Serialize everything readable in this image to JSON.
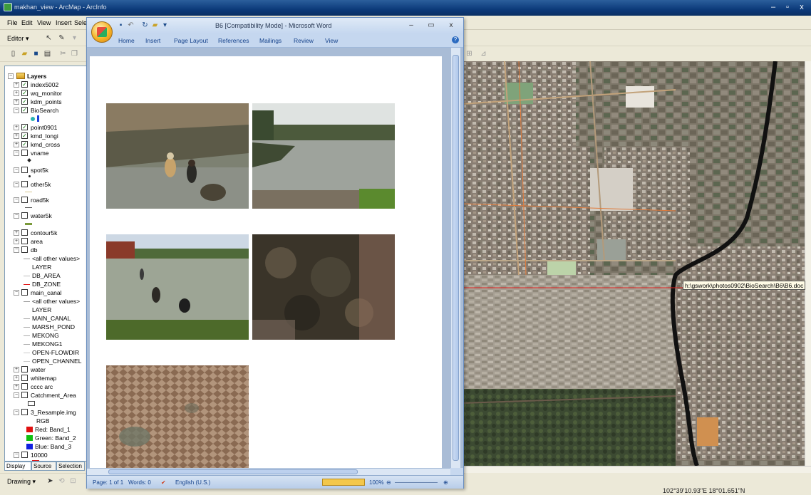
{
  "arcmap": {
    "title": "makhan_view - ArcMap - ArcInfo",
    "window_buttons": [
      "–",
      "▫",
      "x"
    ],
    "menu": [
      "File",
      "Edit",
      "View",
      "Insert",
      "Selec"
    ],
    "editor_label": "Editor ▾",
    "toc": {
      "root": "Layers",
      "layers": [
        {
          "name": "index5002",
          "checked": true
        },
        {
          "name": "wq_monitor",
          "checked": true
        },
        {
          "name": "kdm_points",
          "checked": true
        },
        {
          "name": "BioSearch",
          "checked": true
        },
        {
          "name": "point0901",
          "checked": true
        },
        {
          "name": "kmd_longi",
          "checked": true
        },
        {
          "name": "kmd_cross",
          "checked": true
        },
        {
          "name": "vname",
          "checked": false
        },
        {
          "name": "spot5k",
          "checked": false
        },
        {
          "name": "other5k",
          "checked": false
        },
        {
          "name": "road5k",
          "checked": false
        },
        {
          "name": "water5k",
          "checked": false
        },
        {
          "name": "contour5k",
          "checked": false
        },
        {
          "name": "area",
          "checked": false
        },
        {
          "name": "db",
          "checked": false
        }
      ],
      "db_legend": [
        "<all other values>",
        "LAYER",
        "DB_AREA",
        "DB_ZONE"
      ],
      "main_canal": "main_canal",
      "main_canal_legend": [
        "<all other values>",
        "LAYER",
        "MAIN_CANAL",
        "MARSH_POND",
        "MEKONG",
        "MEKONG1",
        "OPEN-FLOWDIR",
        "OPEN_CHANNEL"
      ],
      "more_layers": [
        "water",
        "whitemap",
        "cccc arc",
        "Catchment_Area",
        "3_Resample.img"
      ],
      "rgb_label": "RGB",
      "rgb": [
        "Red:  Band_1",
        "Green: Band_2",
        "Blue:  Band_3"
      ],
      "last_layer": "10000",
      "tabs": [
        "Display",
        "Source",
        "Selection"
      ]
    },
    "drawing_label": "Drawing ▾",
    "coordinates": "102°39'10.93\"E  18°01.651\"N",
    "map_tooltip": "h:\\gswork\\photos0902\\BioSearch\\B6\\B6.doc",
    "colors": {
      "red": "#e01010",
      "green": "#10c010",
      "blue": "#1020e0"
    }
  },
  "word": {
    "title": "B6 [Compatibility Mode] - Microsoft Word",
    "tabs": [
      "Home",
      "Insert",
      "Page Layout",
      "References",
      "Mailings",
      "Review",
      "View"
    ],
    "status": {
      "page": "Page: 1 of 1",
      "words": "Words: 0",
      "language": "English (U.S.)",
      "zoom": "100%"
    },
    "window_buttons": [
      "–",
      "▭",
      "x"
    ]
  }
}
